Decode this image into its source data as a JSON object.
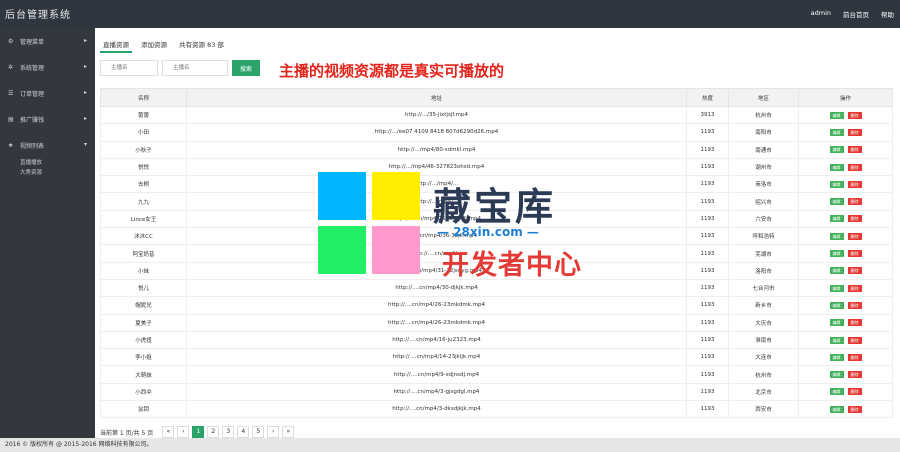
{
  "app": {
    "title": "后台管理系统"
  },
  "topnav": [
    "admin",
    "前台首页",
    "帮助"
  ],
  "sidebar": {
    "items": [
      {
        "label": "管理菜单",
        "icon": "gear-icon"
      },
      {
        "label": "系统管理",
        "icon": "cogs-icon"
      },
      {
        "label": "订单管理",
        "icon": "list-icon"
      },
      {
        "label": "推广赚钱",
        "icon": "ticket-icon"
      },
      {
        "label": "视频列表",
        "icon": "star-icon"
      }
    ],
    "submenu": [
      "直播播放",
      "大秀资源"
    ]
  },
  "tabs": [
    "直播资源",
    "添加资源",
    "共有资源 83 部"
  ],
  "search": {
    "field1_placeholder": "主播名",
    "field2_placeholder": "主播名",
    "button_label": "搜索"
  },
  "notice": "主播的视频资源都是真实可播放的",
  "table": {
    "headers": [
      "名称",
      "地址",
      "热度",
      "地区",
      "操作"
    ],
    "rows": [
      [
        "蕾蕾",
        "http://.../35-jixtjsjf.mp4",
        "3913",
        "杭州市"
      ],
      [
        "小田",
        "http://.../ee07 4109 8418 807d6290d26.mp4",
        "1193",
        "南阳市"
      ],
      [
        "小秋子",
        "http://.../mp4/80-sdmkl.mp4",
        "1193",
        "南通市"
      ],
      [
        "悦悦",
        "http://.../mp4/46-327823ohsd.mp4",
        "1193",
        "湖州市"
      ],
      [
        "去桐",
        "http://.../mp4/...",
        "1193",
        "商洛市"
      ],
      [
        "九九",
        "http://.../mp4/...",
        "1193",
        "绍兴市"
      ],
      [
        "Lince女王",
        "http://....cn/mp4/26-jdyjdsfj.mp4",
        "1193",
        "六安市"
      ],
      [
        "沐沐CC",
        "http://....cn/mp4/36-32jk.mp4",
        "1193",
        "呼和浩特"
      ],
      [
        "阿宝奶昔",
        "http://....cn/mp4/...",
        "1193",
        "芜湖市"
      ],
      [
        "小妹",
        "http://....cn/mp4/31-32jsdyg.mp4",
        "1193",
        "洛阳市"
      ],
      [
        "悦儿",
        "http://....cn/mp4/30-djkjk.mp4",
        "1193",
        "七台河市"
      ],
      [
        "帽妮兒",
        "http://....cn/mp4/26-23mkdmk.mp4",
        "1193",
        "新乡市"
      ],
      [
        "夏美子",
        "http://....cn/mp4/26-23mkdmk.mp4",
        "1193",
        "大庆市"
      ],
      [
        "小虎妞",
        "http://....cn/mp4/16-ju2323.mp4",
        "1193",
        "淮南市"
      ],
      [
        "李小姐",
        "http://....cn/mp4/14-23jkljk.mp4",
        "1193",
        "大连市"
      ],
      [
        "大萌妹",
        "http://....cn/mp4/9-sdjnsdj.mp4",
        "1193",
        "杭州市"
      ],
      [
        "小西伞",
        "http://....cn/mp4/3-gjsgdgl.mp4",
        "1193",
        "北京市"
      ],
      [
        "惢钥",
        "http://....cn/mp4/3-dksdjkjk.mp4",
        "1193",
        "西安市"
      ]
    ],
    "op_edit": "编辑",
    "op_delete": "删除"
  },
  "pager": {
    "info": "当前第 1 页/共 5 页",
    "first": "«",
    "prev": "‹",
    "pages": [
      "1",
      "2",
      "3",
      "4",
      "5"
    ],
    "next": "›",
    "last": "»"
  },
  "footer": "2016 © 版权所有 @ 2015-2016 网络科技有限公司。",
  "watermark": {
    "line1": "藏宝库",
    "line2": "— 28xin.com —",
    "line3": "开发者中心",
    "colors": [
      "#00b4ff",
      "#ffee00",
      "#22ee66",
      "#ff99cc"
    ]
  }
}
